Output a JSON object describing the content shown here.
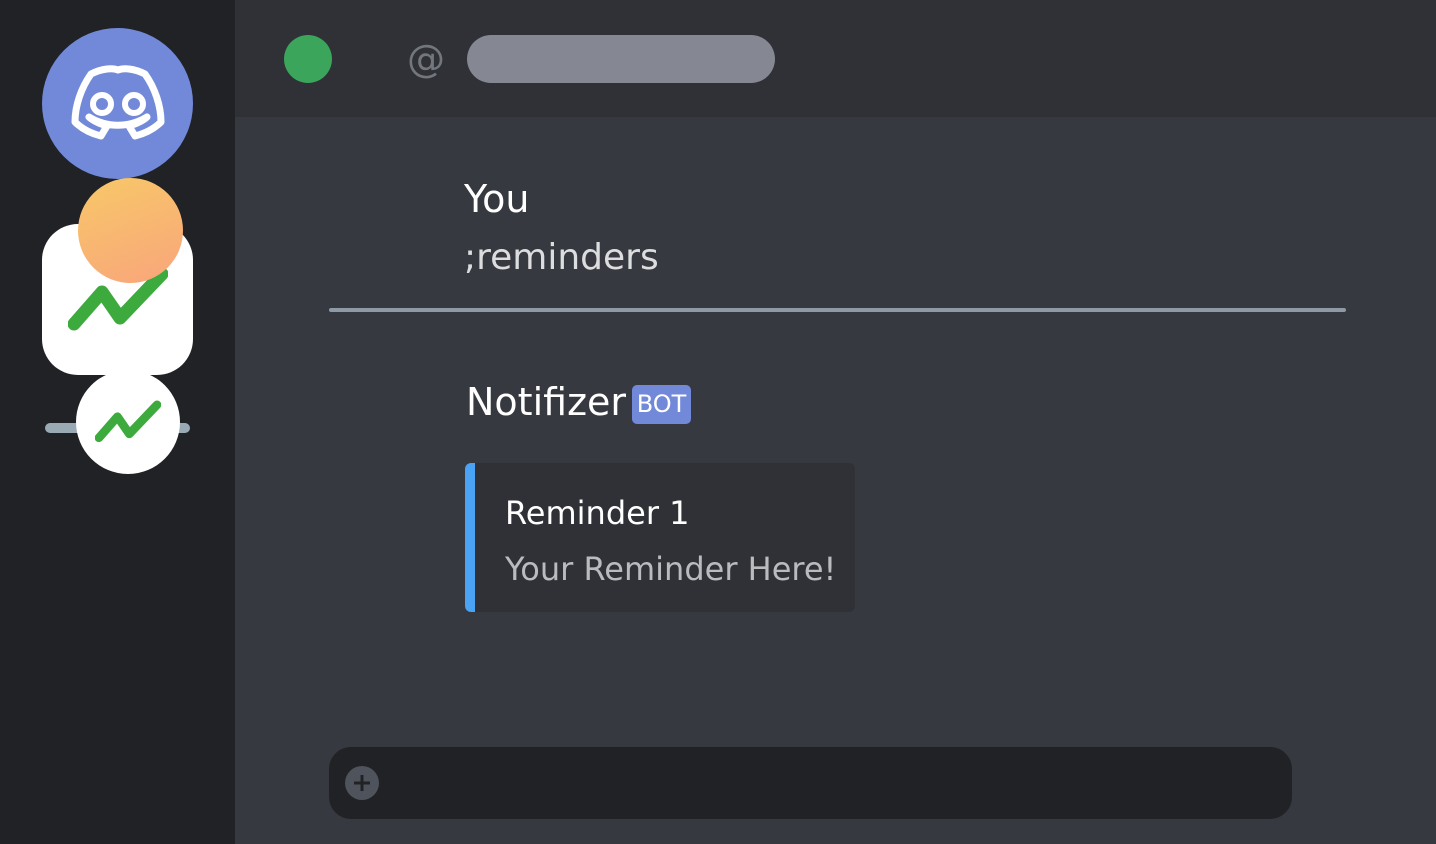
{
  "sidebar": {
    "servers": [
      {
        "icon": "discord-logo-icon",
        "color": "#7289da"
      },
      {
        "icon": "notifizer-logo-icon",
        "color": "#ffffff"
      }
    ]
  },
  "header": {
    "status_color": "#3ba55c",
    "at_symbol": "@"
  },
  "messages": [
    {
      "author": "You",
      "content": ";reminders"
    },
    {
      "author": "Notifizer",
      "tag": "BOT",
      "embed": {
        "accent_color": "#4aa3f5",
        "title": "Reminder 1",
        "description": "Your Reminder Here!"
      }
    }
  ],
  "composer": {
    "attach_icon": "plus-circle-icon"
  },
  "colors": {
    "brand": "#7289da",
    "logo_green": "#3daa3d"
  }
}
